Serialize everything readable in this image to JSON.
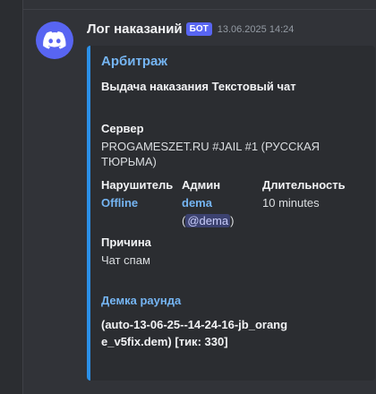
{
  "message": {
    "username": "Лог наказаний",
    "bot_tag": "БОТ",
    "timestamp": "13.06.2025 14:24",
    "avatar_icon": "discord-logo-icon"
  },
  "embed": {
    "accent_color": "#2b90e8",
    "author": "Арбитраж",
    "description": "Выдача наказания Текстовый чат",
    "server": {
      "name": "Сервер",
      "value": "PROGAMESZET.RU #JAIL #1 (РУССКАЯ ТЮРЬМА)"
    },
    "violator": {
      "name": "Нарушитель",
      "value": "Offline"
    },
    "admin": {
      "name": "Админ",
      "value": "dema",
      "mention_open": "(",
      "mention": "@dema",
      "mention_close": ")"
    },
    "duration": {
      "name": "Длительность",
      "value": "10 minutes"
    },
    "reason": {
      "name": "Причина",
      "value": "Чат спам"
    },
    "demo": {
      "name": "Демка раунда",
      "value": "(auto-13-06-25--14-24-16-jb_orange_v5fix.dem) [тик: 330]"
    }
  }
}
